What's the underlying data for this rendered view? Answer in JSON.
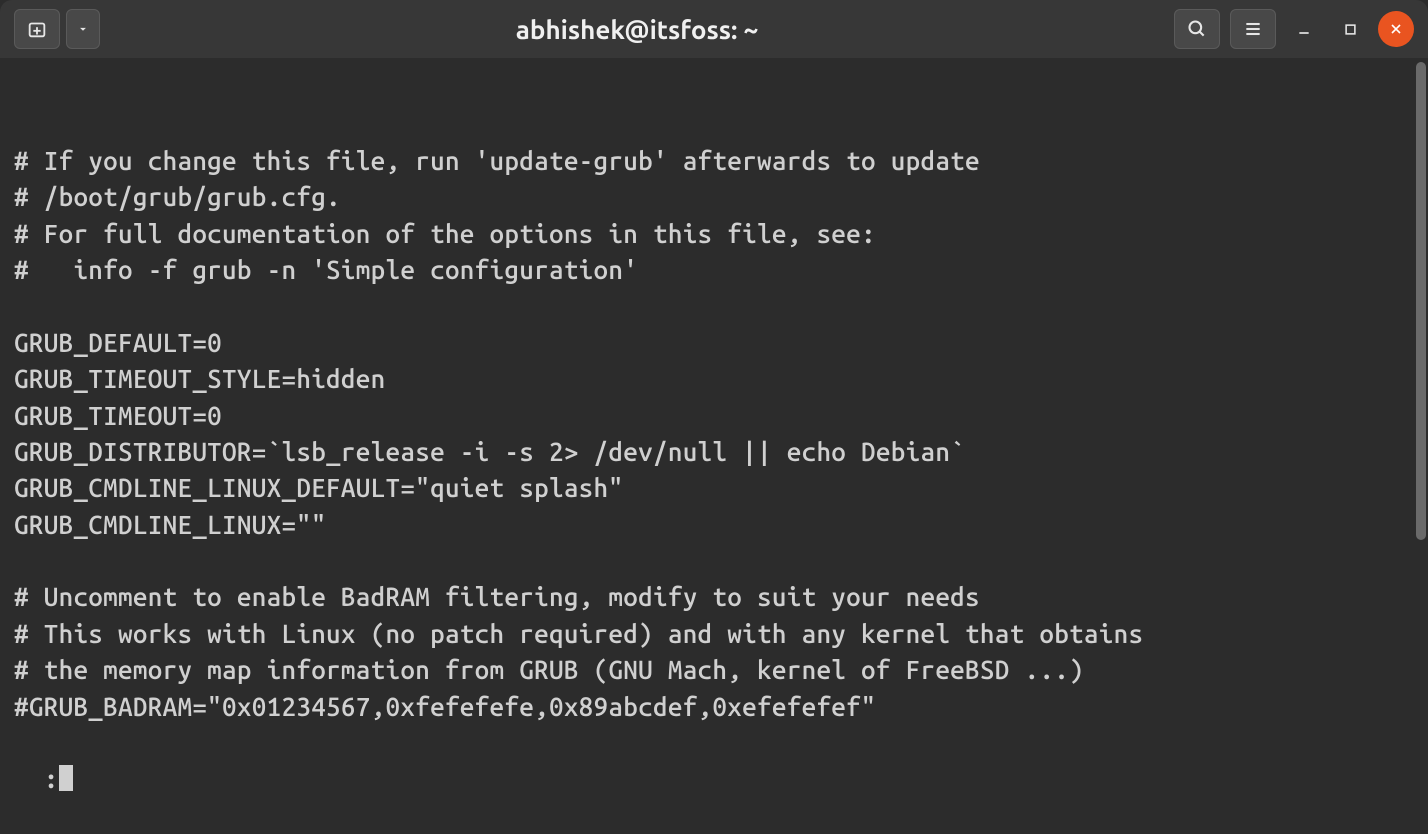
{
  "window": {
    "title": "abhishek@itsfoss: ~"
  },
  "terminal": {
    "lines": [
      "# If you change this file, run 'update-grub' afterwards to update",
      "# /boot/grub/grub.cfg.",
      "# For full documentation of the options in this file, see:",
      "#   info -f grub -n 'Simple configuration'",
      "",
      "GRUB_DEFAULT=0",
      "GRUB_TIMEOUT_STYLE=hidden",
      "GRUB_TIMEOUT=0",
      "GRUB_DISTRIBUTOR=`lsb_release -i -s 2> /dev/null || echo Debian`",
      "GRUB_CMDLINE_LINUX_DEFAULT=\"quiet splash\"",
      "GRUB_CMDLINE_LINUX=\"\"",
      "",
      "# Uncomment to enable BadRAM filtering, modify to suit your needs",
      "# This works with Linux (no patch required) and with any kernel that obtains",
      "# the memory map information from GRUB (GNU Mach, kernel of FreeBSD ...)",
      "#GRUB_BADRAM=\"0x01234567,0xfefefefe,0x89abcdef,0xefefefef\""
    ],
    "prompt": ":"
  }
}
